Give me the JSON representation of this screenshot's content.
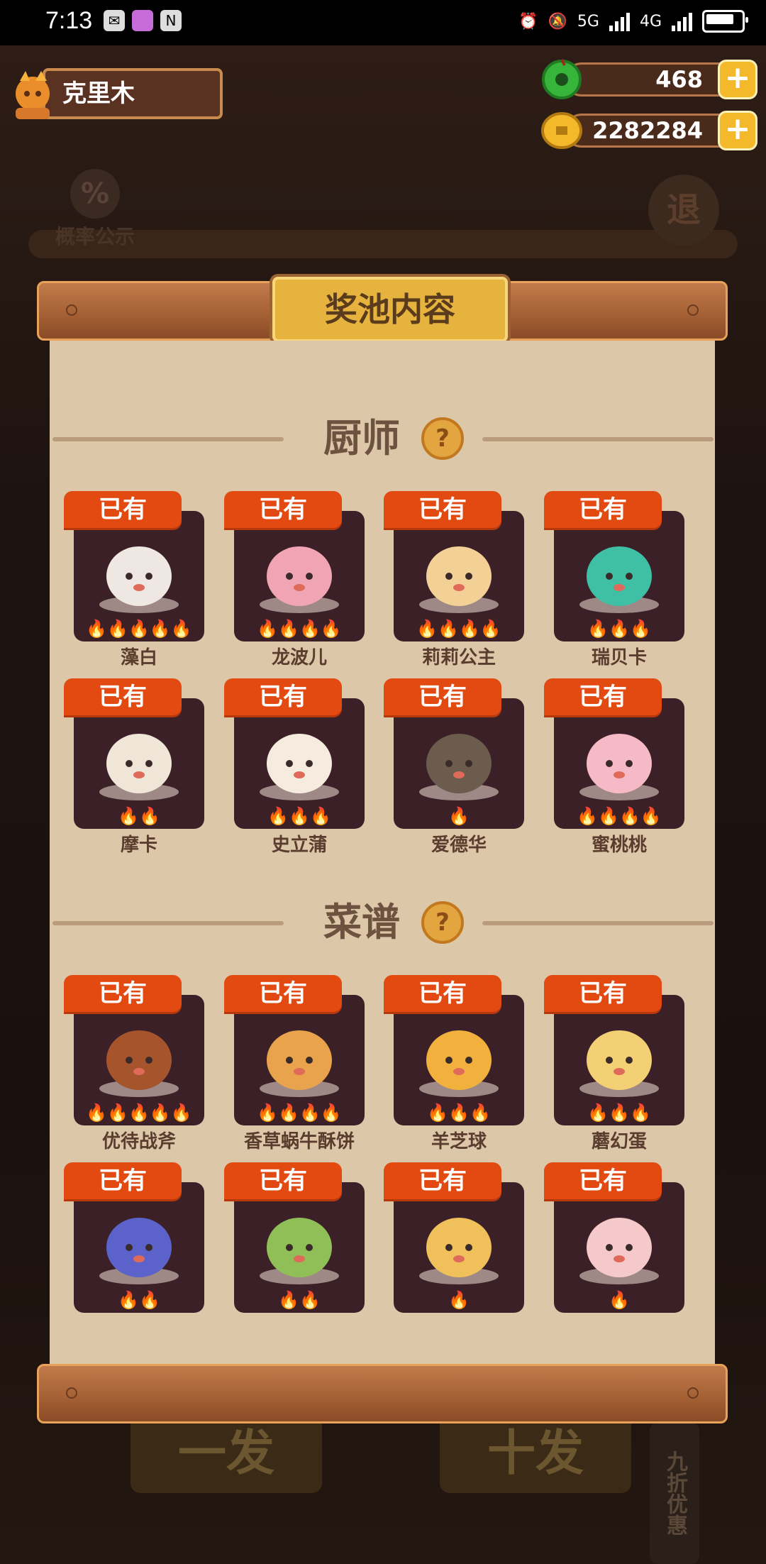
{
  "status_bar": {
    "time": "7:13",
    "net1": "5G",
    "net2": "4G"
  },
  "player": {
    "name": "克里木"
  },
  "resources": {
    "jade": "468",
    "coins": "2282284"
  },
  "background": {
    "probability_label": "概率公示",
    "exit_label": "退",
    "single_draw": "一发",
    "ten_draw": "十发",
    "discount": "九折优惠"
  },
  "modal": {
    "title": "奖池内容",
    "chefs": {
      "title": "厨师",
      "items": [
        {
          "tag": "已有",
          "name": "藻白",
          "stars": 5,
          "color": "#efe7e1"
        },
        {
          "tag": "已有",
          "name": "龙波儿",
          "stars": 4,
          "color": "#f1a5b4"
        },
        {
          "tag": "已有",
          "name": "莉莉公主",
          "stars": 4,
          "color": "#f3d196"
        },
        {
          "tag": "已有",
          "name": "瑞贝卡",
          "stars": 3,
          "color": "#3fbfa4"
        },
        {
          "tag": "已有",
          "name": "摩卡",
          "stars": 2,
          "color": "#f0e6d8"
        },
        {
          "tag": "已有",
          "name": "史立蒲",
          "stars": 3,
          "color": "#f5ebde"
        },
        {
          "tag": "已有",
          "name": "爱德华",
          "stars": 1,
          "color": "#6b5c4d"
        },
        {
          "tag": "已有",
          "name": "蜜桃桃",
          "stars": 4,
          "color": "#f6b9c6"
        }
      ]
    },
    "recipes": {
      "title": "菜谱",
      "items": [
        {
          "tag": "已有",
          "name": "优待战斧",
          "stars": 5,
          "color": "#a6542c"
        },
        {
          "tag": "已有",
          "name": "香草蜗牛酥饼",
          "stars": 4,
          "color": "#e9a34c"
        },
        {
          "tag": "已有",
          "name": "羊芝球",
          "stars": 3,
          "color": "#f2b13c"
        },
        {
          "tag": "已有",
          "name": "蘑幻蛋",
          "stars": 3,
          "color": "#f2d073"
        },
        {
          "tag": "已有",
          "name": "",
          "stars": 2,
          "color": "#5b62c9"
        },
        {
          "tag": "已有",
          "name": "",
          "stars": 2,
          "color": "#8fbf56"
        },
        {
          "tag": "已有",
          "name": "",
          "stars": 1,
          "color": "#f0c05a"
        },
        {
          "tag": "已有",
          "name": "",
          "stars": 1,
          "color": "#f5c9c9"
        }
      ]
    }
  }
}
